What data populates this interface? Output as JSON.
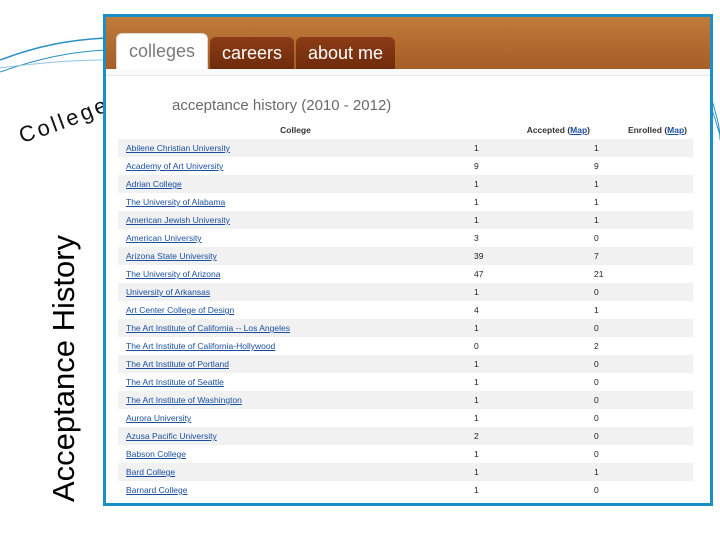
{
  "slide": {
    "curved_title": "College Tab",
    "vertical_title": "Acceptance History"
  },
  "tabs": [
    {
      "label": "colleges",
      "active": true
    },
    {
      "label": "careers",
      "active": false
    },
    {
      "label": "about me",
      "active": false
    }
  ],
  "section": {
    "heading": "acceptance history (2010 - 2012)"
  },
  "table": {
    "headers": {
      "college": "College",
      "accepted": "Accepted",
      "enrolled": "Enrolled",
      "map_link": "Map"
    },
    "rows": [
      {
        "name": "Abilene Christian University",
        "accepted": "1",
        "enrolled": "1"
      },
      {
        "name": "Academy of Art University",
        "accepted": "9",
        "enrolled": "9"
      },
      {
        "name": "Adrian College",
        "accepted": "1",
        "enrolled": "1"
      },
      {
        "name": "The University of Alabama",
        "accepted": "1",
        "enrolled": "1"
      },
      {
        "name": "American Jewish University",
        "accepted": "1",
        "enrolled": "1"
      },
      {
        "name": "American University",
        "accepted": "3",
        "enrolled": "0"
      },
      {
        "name": "Arizona State University",
        "accepted": "39",
        "enrolled": "7"
      },
      {
        "name": "The University of Arizona",
        "accepted": "47",
        "enrolled": "21"
      },
      {
        "name": "University of Arkansas",
        "accepted": "1",
        "enrolled": "0"
      },
      {
        "name": "Art Center College of Design",
        "accepted": "4",
        "enrolled": "1"
      },
      {
        "name": "The Art Institute of California -- Los Angeles",
        "accepted": "1",
        "enrolled": "0"
      },
      {
        "name": "The Art Institute of California-Hollywood",
        "accepted": "0",
        "enrolled": "2"
      },
      {
        "name": "The Art Institute of Portland",
        "accepted": "1",
        "enrolled": "0"
      },
      {
        "name": "The Art Institute of Seattle",
        "accepted": "1",
        "enrolled": "0"
      },
      {
        "name": "The Art Institute of Washington",
        "accepted": "1",
        "enrolled": "0"
      },
      {
        "name": "Aurora University",
        "accepted": "1",
        "enrolled": "0"
      },
      {
        "name": "Azusa Pacific University",
        "accepted": "2",
        "enrolled": "0"
      },
      {
        "name": "Babson College",
        "accepted": "1",
        "enrolled": "0"
      },
      {
        "name": "Bard College",
        "accepted": "1",
        "enrolled": "1"
      },
      {
        "name": "Barnard College",
        "accepted": "1",
        "enrolled": "0"
      }
    ]
  },
  "colors": {
    "frame_border": "#1a90c8",
    "tab_bar": "#b86e33",
    "tab_inactive": "#7a330f",
    "link": "#1a4fa0"
  }
}
